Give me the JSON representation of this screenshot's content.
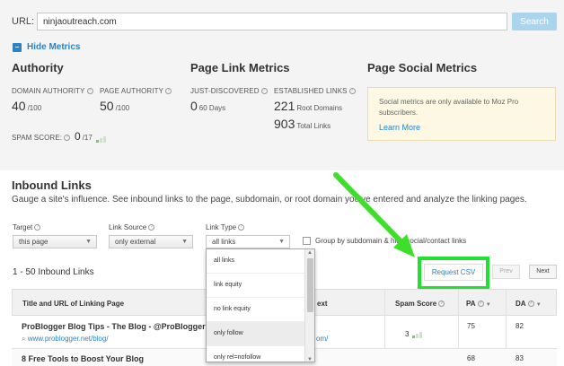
{
  "url_bar": {
    "label": "URL:",
    "value": "ninjaoutreach.com",
    "search_label": "Search"
  },
  "hide_metrics": {
    "icon": "minus",
    "label": "Hide Metrics"
  },
  "authority": {
    "title": "Authority",
    "domain_authority": {
      "label": "DOMAIN AUTHORITY",
      "value": "40",
      "out_of": "/100"
    },
    "page_authority": {
      "label": "PAGE AUTHORITY",
      "value": "50",
      "out_of": "/100"
    },
    "spam_score": {
      "label": "SPAM SCORE:",
      "value": "0",
      "out_of": "/17"
    }
  },
  "page_link_metrics": {
    "title": "Page Link Metrics",
    "just_discovered": {
      "label": "JUST-DISCOVERED",
      "value": "0",
      "period": "60 Days"
    },
    "established_links": {
      "label": "ESTABLISHED LINKS",
      "root_domains_value": "221",
      "root_domains_label": "Root Domains",
      "total_links_value": "903",
      "total_links_label": "Total Links"
    }
  },
  "page_social_metrics": {
    "title": "Page Social Metrics",
    "notice": "Social metrics are only available to Moz Pro subscribers.",
    "learn_more": "Learn More"
  },
  "inbound": {
    "title": "Inbound Links",
    "description": "Gauge a site's influence. See inbound links to the page, subdomain, or root domain you've entered and analyze the linking pages.",
    "filters": {
      "target": {
        "label": "Target",
        "value": "this page"
      },
      "link_source": {
        "label": "Link Source",
        "value": "only external"
      },
      "link_type": {
        "label": "Link Type",
        "value": "all links"
      },
      "group_label": "Group by subdomain & hide social/contact links"
    },
    "count_label": "1 - 50 Inbound Links",
    "request_csv": "Request CSV",
    "prev": "Prev",
    "next": "Next"
  },
  "link_type_options": [
    "all links",
    "link equity",
    "no link equity",
    "only follow",
    "only rel=nofollow"
  ],
  "table": {
    "headers": {
      "title_url": "Title and URL of Linking Page",
      "anchor": "ext",
      "spam": "Spam Score",
      "pa": "PA",
      "da": "DA"
    },
    "rows": [
      {
        "title": "ProBlogger Blog Tips - The Blog - @ProBlogger",
        "url": "www.problogger.net/blog/",
        "anchor": "om/",
        "spam": "3",
        "pa": "75",
        "da": "82"
      },
      {
        "title": "8 Free Tools to Boost Your Blog",
        "url": "",
        "anchor": "",
        "spam": "",
        "pa": "68",
        "da": "83"
      }
    ]
  },
  "colors": {
    "accent": "#2a83c4",
    "highlight": "#22e030",
    "arrow": "#3ddf2a"
  }
}
